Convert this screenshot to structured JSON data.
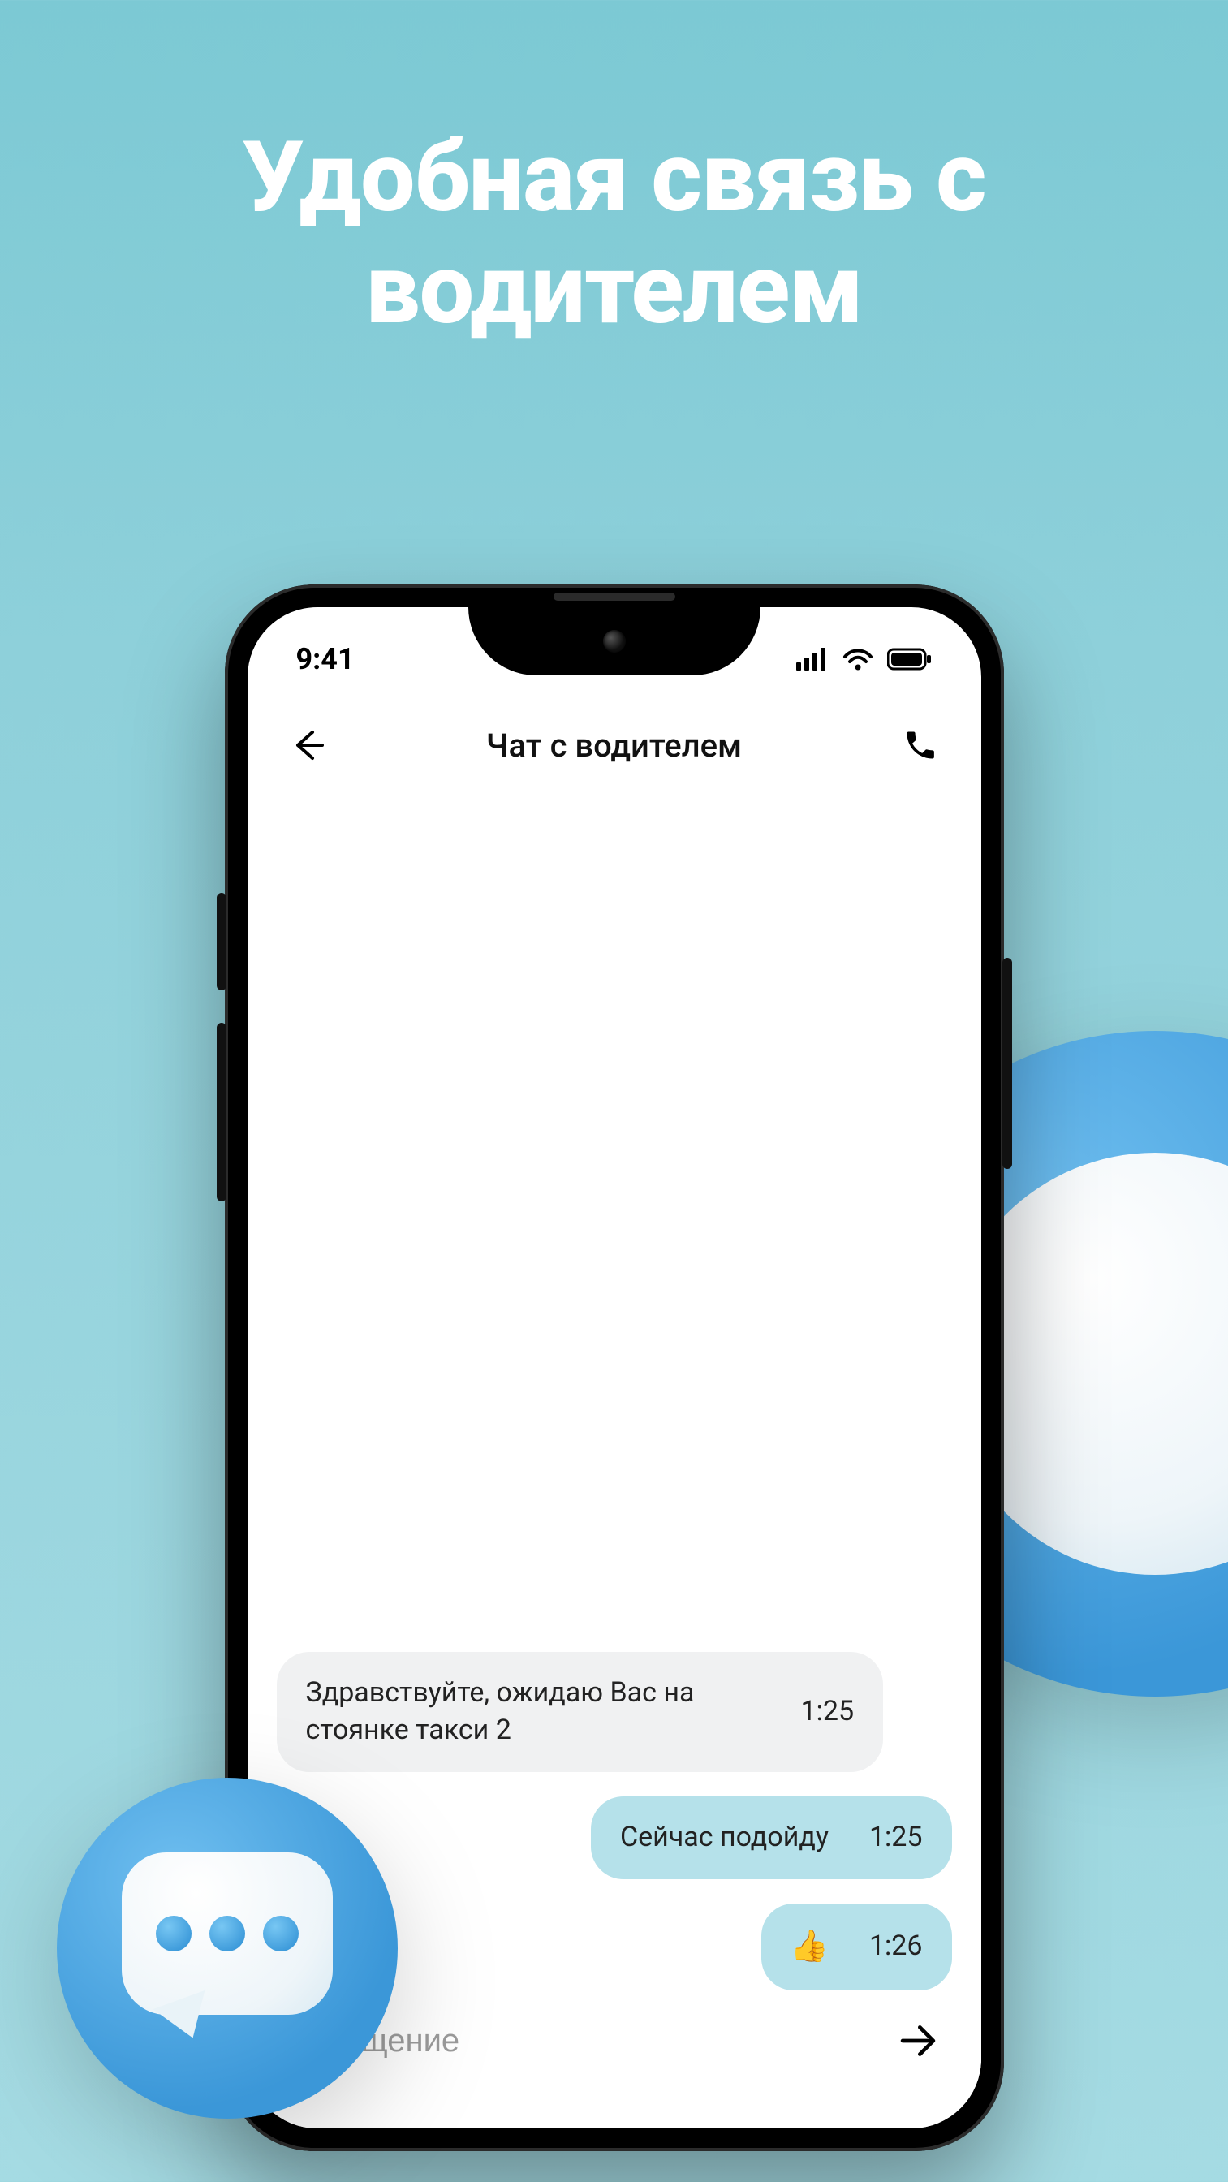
{
  "promo": {
    "title": "Удобная связь с водителем"
  },
  "status": {
    "time": "9:41"
  },
  "nav": {
    "title": "Чат с водителем"
  },
  "messages": [
    {
      "direction": "in",
      "text": "Здравствуйте, ожидаю Вас на стоянке такси 2",
      "time": "1:25"
    },
    {
      "direction": "out",
      "text": "Сейчас подойду",
      "time": "1:25"
    },
    {
      "direction": "out",
      "text": "👍",
      "time": "1:26"
    }
  ],
  "composer": {
    "placeholder": "Сообщение"
  }
}
